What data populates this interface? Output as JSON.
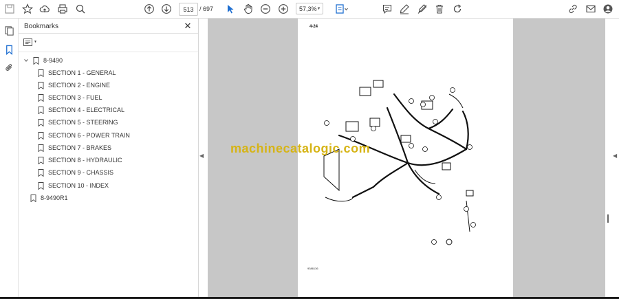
{
  "toolbar": {
    "page_current": "513",
    "page_total": "/ 697",
    "zoom_value": "57,3%"
  },
  "bookmarks": {
    "title": "Bookmarks",
    "root": "8-9490",
    "items": [
      "SECTION 1 - GENERAL",
      "SECTION 2 - ENGINE",
      "SECTION 3 - FUEL",
      "SECTION 4 - ELECTRICAL",
      "SECTION 5 - STEERING",
      "SECTION 6 - POWER TRAIN",
      "SECTION 7 - BRAKES",
      "SECTION 8 - HYDRAULIC",
      "SECTION 9 - CHASSIS",
      "SECTION 10 - INDEX"
    ],
    "second_root": "8-9490R1"
  },
  "document": {
    "page_label": "4-24",
    "drawing_code": "9386136"
  },
  "watermark": "machinecatalogic.com",
  "colors": {
    "viewer_bg": "#c7c7c7",
    "accent_blue": "#1f6fd1",
    "watermark": "#d6b416"
  }
}
